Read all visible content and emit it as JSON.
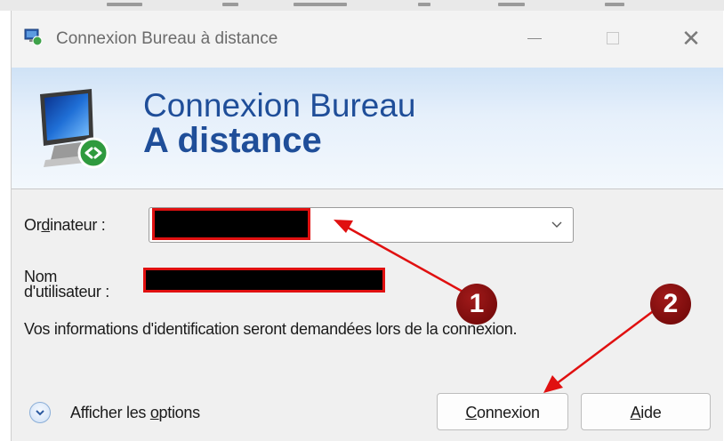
{
  "window": {
    "title": "Connexion Bureau à distance",
    "controls": {
      "minimize": "—",
      "maximize": "☐",
      "close": "✕"
    }
  },
  "banner": {
    "line1": "Connexion Bureau",
    "line2": "A distance"
  },
  "form": {
    "computer_label_pre": "Or",
    "computer_label_mnemonic": "d",
    "computer_label_post": "inateur :",
    "computer_value": "",
    "username_label_line1": "Nom",
    "username_label_line2": "d'utilisateur :",
    "username_value": "",
    "info_text": "Vos informations d'identification seront demandées lors de la connexion."
  },
  "footer": {
    "options_pre": "Afficher les ",
    "options_mnemonic": "o",
    "options_post": "ptions",
    "connect_mnemonic": "C",
    "connect_rest": "onnexion",
    "help_mnemonic": "A",
    "help_rest": "ide"
  },
  "annotations": {
    "badge1": "1",
    "badge2": "2",
    "color": "#e01010"
  },
  "icons": [
    "remote-desktop-icon",
    "monitor-icon",
    "chevron-down-icon",
    "expand-options-icon"
  ]
}
